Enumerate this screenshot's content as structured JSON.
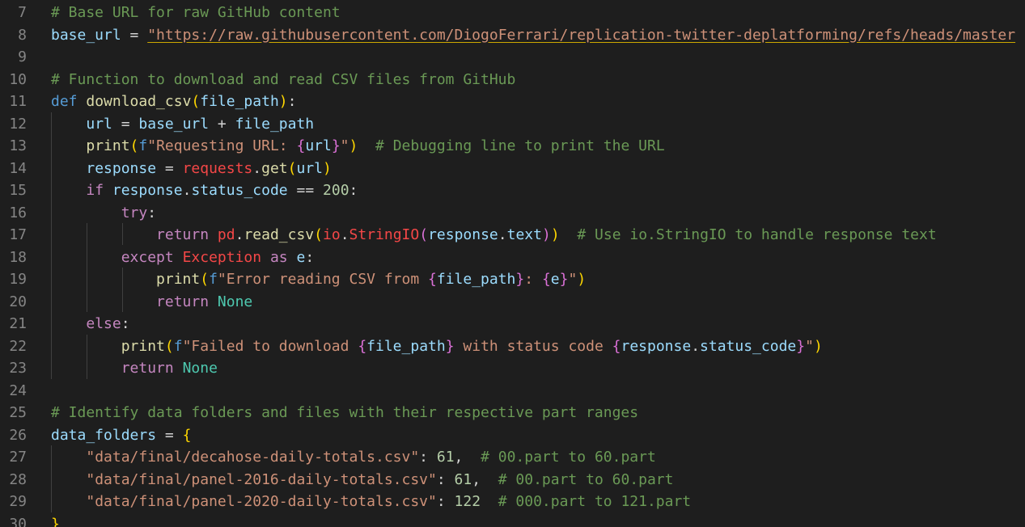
{
  "editor": {
    "lines": [
      {
        "num": "7",
        "tokens": [
          {
            "t": "# Base URL for raw GitHub content",
            "c": "cm"
          }
        ]
      },
      {
        "num": "8",
        "tokens": [
          {
            "t": "base_url",
            "c": "var"
          },
          {
            "t": " = ",
            "c": "pl"
          },
          {
            "t": "\"https://raw.githubusercontent.com/DiogoFerrari/replication-twitter-deplatforming/refs/heads/master",
            "c": "str url-underline"
          }
        ]
      },
      {
        "num": "9",
        "tokens": []
      },
      {
        "num": "10",
        "tokens": [
          {
            "t": "# Function to download and read CSV files from GitHub",
            "c": "cm"
          }
        ]
      },
      {
        "num": "11",
        "tokens": [
          {
            "t": "def",
            "c": "kw"
          },
          {
            "t": " ",
            "c": "pl"
          },
          {
            "t": "download_csv",
            "c": "fn"
          },
          {
            "t": "(",
            "c": "br1"
          },
          {
            "t": "file_path",
            "c": "var"
          },
          {
            "t": ")",
            "c": "br1"
          },
          {
            "t": ":",
            "c": "pl"
          }
        ]
      },
      {
        "num": "12",
        "tokens": [
          {
            "t": "    ",
            "c": "pl"
          },
          {
            "t": "url",
            "c": "var"
          },
          {
            "t": " = ",
            "c": "pl"
          },
          {
            "t": "base_url",
            "c": "var"
          },
          {
            "t": " + ",
            "c": "pl"
          },
          {
            "t": "file_path",
            "c": "var"
          }
        ]
      },
      {
        "num": "13",
        "tokens": [
          {
            "t": "    ",
            "c": "pl"
          },
          {
            "t": "print",
            "c": "fn"
          },
          {
            "t": "(",
            "c": "br1"
          },
          {
            "t": "f",
            "c": "kw"
          },
          {
            "t": "\"Requesting URL: ",
            "c": "str"
          },
          {
            "t": "{",
            "c": "br2"
          },
          {
            "t": "url",
            "c": "var"
          },
          {
            "t": "}",
            "c": "br2"
          },
          {
            "t": "\"",
            "c": "str"
          },
          {
            "t": ")",
            "c": "br1"
          },
          {
            "t": "  ",
            "c": "pl"
          },
          {
            "t": "# Debugging line to print the URL",
            "c": "cm"
          }
        ]
      },
      {
        "num": "14",
        "tokens": [
          {
            "t": "    ",
            "c": "pl"
          },
          {
            "t": "response",
            "c": "var"
          },
          {
            "t": " = ",
            "c": "pl"
          },
          {
            "t": "requests",
            "c": "err"
          },
          {
            "t": ".",
            "c": "pl"
          },
          {
            "t": "get",
            "c": "fn"
          },
          {
            "t": "(",
            "c": "br1"
          },
          {
            "t": "url",
            "c": "var"
          },
          {
            "t": ")",
            "c": "br1"
          }
        ]
      },
      {
        "num": "15",
        "tokens": [
          {
            "t": "    ",
            "c": "pl"
          },
          {
            "t": "if",
            "c": "kwc"
          },
          {
            "t": " ",
            "c": "pl"
          },
          {
            "t": "response",
            "c": "var"
          },
          {
            "t": ".",
            "c": "pl"
          },
          {
            "t": "status_code",
            "c": "var"
          },
          {
            "t": " == ",
            "c": "pl"
          },
          {
            "t": "200",
            "c": "num"
          },
          {
            "t": ":",
            "c": "pl"
          }
        ]
      },
      {
        "num": "16",
        "tokens": [
          {
            "t": "        ",
            "c": "pl"
          },
          {
            "t": "try",
            "c": "kwc"
          },
          {
            "t": ":",
            "c": "pl"
          }
        ]
      },
      {
        "num": "17",
        "tokens": [
          {
            "t": "            ",
            "c": "pl"
          },
          {
            "t": "return",
            "c": "kwc"
          },
          {
            "t": " ",
            "c": "pl"
          },
          {
            "t": "pd",
            "c": "err"
          },
          {
            "t": ".",
            "c": "pl"
          },
          {
            "t": "read_csv",
            "c": "fn"
          },
          {
            "t": "(",
            "c": "br1"
          },
          {
            "t": "io",
            "c": "err"
          },
          {
            "t": ".",
            "c": "pl"
          },
          {
            "t": "StringIO",
            "c": "err"
          },
          {
            "t": "(",
            "c": "br2"
          },
          {
            "t": "response",
            "c": "var"
          },
          {
            "t": ".",
            "c": "pl"
          },
          {
            "t": "text",
            "c": "var"
          },
          {
            "t": ")",
            "c": "br2"
          },
          {
            "t": ")",
            "c": "br1"
          },
          {
            "t": "  ",
            "c": "pl"
          },
          {
            "t": "# Use io.StringIO to handle response text",
            "c": "cm"
          }
        ]
      },
      {
        "num": "18",
        "tokens": [
          {
            "t": "        ",
            "c": "pl"
          },
          {
            "t": "except",
            "c": "kwc"
          },
          {
            "t": " ",
            "c": "pl"
          },
          {
            "t": "Exception",
            "c": "err"
          },
          {
            "t": " ",
            "c": "pl"
          },
          {
            "t": "as",
            "c": "kwc"
          },
          {
            "t": " ",
            "c": "pl"
          },
          {
            "t": "e",
            "c": "var"
          },
          {
            "t": ":",
            "c": "pl"
          }
        ]
      },
      {
        "num": "19",
        "tokens": [
          {
            "t": "            ",
            "c": "pl"
          },
          {
            "t": "print",
            "c": "fn"
          },
          {
            "t": "(",
            "c": "br1"
          },
          {
            "t": "f",
            "c": "kw"
          },
          {
            "t": "\"Error reading CSV from ",
            "c": "str"
          },
          {
            "t": "{",
            "c": "br2"
          },
          {
            "t": "file_path",
            "c": "var"
          },
          {
            "t": "}",
            "c": "br2"
          },
          {
            "t": ": ",
            "c": "str"
          },
          {
            "t": "{",
            "c": "br2"
          },
          {
            "t": "e",
            "c": "var"
          },
          {
            "t": "}",
            "c": "br2"
          },
          {
            "t": "\"",
            "c": "str"
          },
          {
            "t": ")",
            "c": "br1"
          }
        ]
      },
      {
        "num": "20",
        "tokens": [
          {
            "t": "            ",
            "c": "pl"
          },
          {
            "t": "return",
            "c": "kwc"
          },
          {
            "t": " ",
            "c": "pl"
          },
          {
            "t": "None",
            "c": "cls"
          }
        ]
      },
      {
        "num": "21",
        "tokens": [
          {
            "t": "    ",
            "c": "pl"
          },
          {
            "t": "else",
            "c": "kwc"
          },
          {
            "t": ":",
            "c": "pl"
          }
        ]
      },
      {
        "num": "22",
        "tokens": [
          {
            "t": "        ",
            "c": "pl"
          },
          {
            "t": "print",
            "c": "fn"
          },
          {
            "t": "(",
            "c": "br1"
          },
          {
            "t": "f",
            "c": "kw"
          },
          {
            "t": "\"Failed to download ",
            "c": "str"
          },
          {
            "t": "{",
            "c": "br2"
          },
          {
            "t": "file_path",
            "c": "var"
          },
          {
            "t": "}",
            "c": "br2"
          },
          {
            "t": " with status code ",
            "c": "str"
          },
          {
            "t": "{",
            "c": "br2"
          },
          {
            "t": "response",
            "c": "var"
          },
          {
            "t": ".",
            "c": "pl"
          },
          {
            "t": "status_code",
            "c": "var"
          },
          {
            "t": "}",
            "c": "br2"
          },
          {
            "t": "\"",
            "c": "str"
          },
          {
            "t": ")",
            "c": "br1"
          }
        ]
      },
      {
        "num": "23",
        "tokens": [
          {
            "t": "        ",
            "c": "pl"
          },
          {
            "t": "return",
            "c": "kwc"
          },
          {
            "t": " ",
            "c": "pl"
          },
          {
            "t": "None",
            "c": "cls"
          }
        ]
      },
      {
        "num": "24",
        "tokens": []
      },
      {
        "num": "25",
        "tokens": [
          {
            "t": "# Identify data folders and files with their respective part ranges",
            "c": "cm"
          }
        ]
      },
      {
        "num": "26",
        "tokens": [
          {
            "t": "data_folders",
            "c": "var"
          },
          {
            "t": " = ",
            "c": "pl"
          },
          {
            "t": "{",
            "c": "br1"
          }
        ]
      },
      {
        "num": "27",
        "tokens": [
          {
            "t": "    ",
            "c": "pl"
          },
          {
            "t": "\"data/final/decahose-daily-totals.csv\"",
            "c": "str"
          },
          {
            "t": ": ",
            "c": "pl"
          },
          {
            "t": "61",
            "c": "num"
          },
          {
            "t": ",  ",
            "c": "pl"
          },
          {
            "t": "# 00.part to 60.part",
            "c": "cm"
          }
        ]
      },
      {
        "num": "28",
        "tokens": [
          {
            "t": "    ",
            "c": "pl"
          },
          {
            "t": "\"data/final/panel-2016-daily-totals.csv\"",
            "c": "str"
          },
          {
            "t": ": ",
            "c": "pl"
          },
          {
            "t": "61",
            "c": "num"
          },
          {
            "t": ",  ",
            "c": "pl"
          },
          {
            "t": "# 00.part to 60.part",
            "c": "cm"
          }
        ]
      },
      {
        "num": "29",
        "tokens": [
          {
            "t": "    ",
            "c": "pl"
          },
          {
            "t": "\"data/final/panel-2020-daily-totals.csv\"",
            "c": "str"
          },
          {
            "t": ": ",
            "c": "pl"
          },
          {
            "t": "122",
            "c": "num"
          },
          {
            "t": "  ",
            "c": "pl"
          },
          {
            "t": "# 000.part to 121.part",
            "c": "cm"
          }
        ]
      },
      {
        "num": "30",
        "tokens": [
          {
            "t": "}",
            "c": "br1"
          }
        ]
      }
    ]
  }
}
